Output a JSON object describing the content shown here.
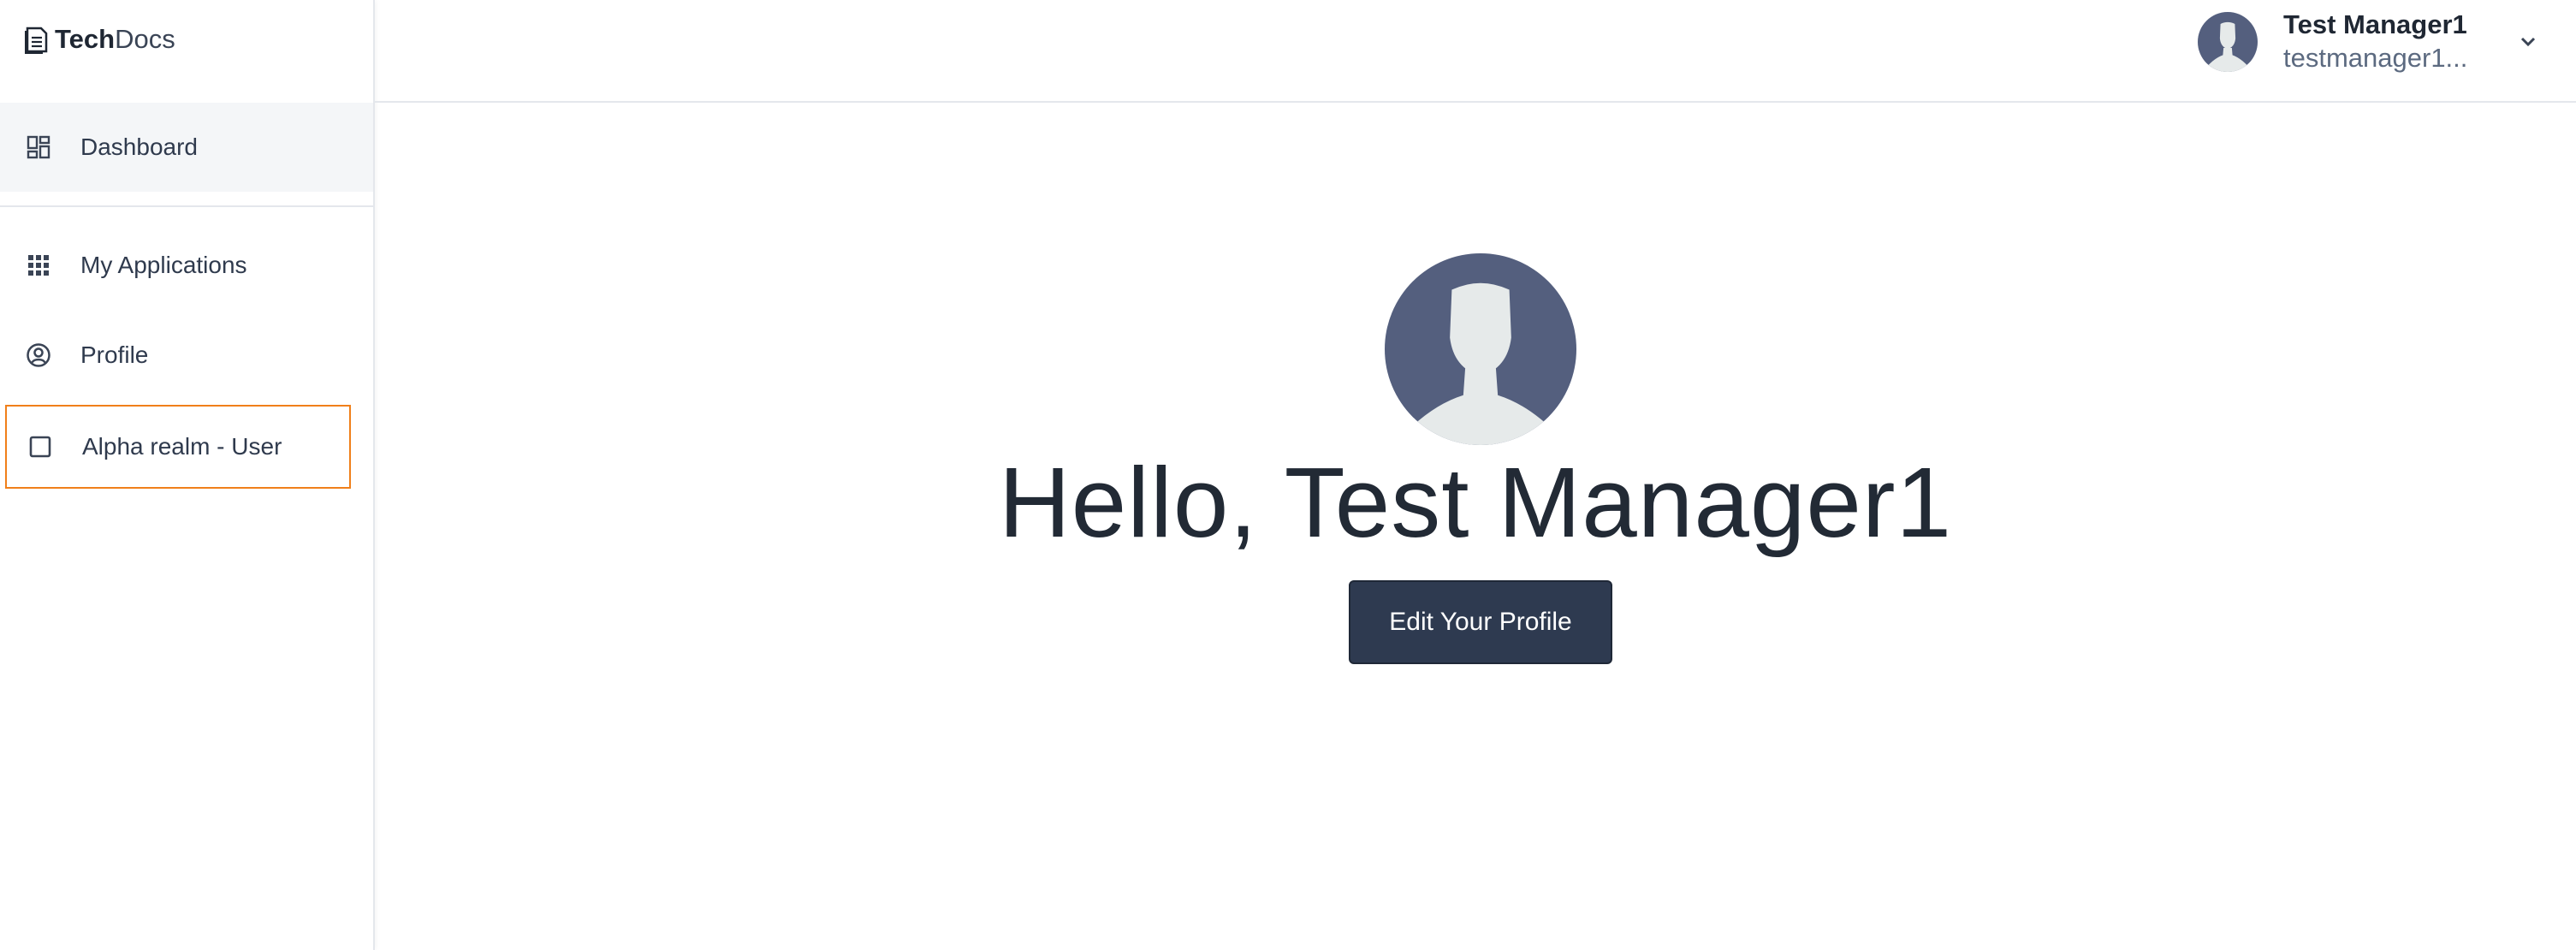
{
  "brand": {
    "bold": "Tech",
    "light": "Docs",
    "icon": "document-icon"
  },
  "sidebar": {
    "items": [
      {
        "label": "Dashboard",
        "icon": "dashboard-icon",
        "active": true
      },
      {
        "label": "My Applications",
        "icon": "apps-grid-icon"
      },
      {
        "label": "Profile",
        "icon": "user-circle-icon"
      },
      {
        "label": "Alpha realm - User",
        "icon": "square-icon",
        "focused": true
      }
    ]
  },
  "header": {
    "user_name": "Test Manager1",
    "user_email": "testmanager1...",
    "menu_icon": "chevron-down-icon"
  },
  "main": {
    "greeting": "Hello, Test Manager1",
    "edit_button_label": "Edit Your Profile"
  },
  "colors": {
    "avatar_bg": "#545f7e",
    "avatar_silhouette": "#e6eaea",
    "button_bg": "#2e3a50",
    "focus_outline": "#f07f1a",
    "active_item_bg": "#f4f6f8"
  }
}
